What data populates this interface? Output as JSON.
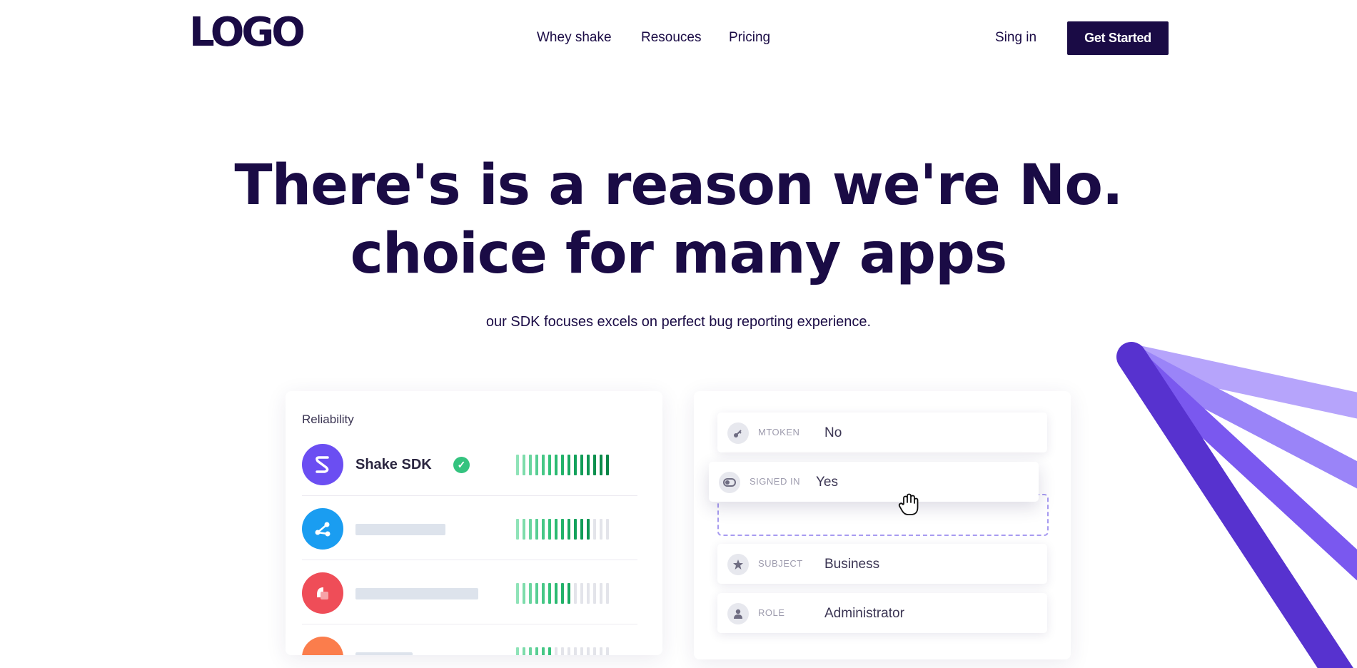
{
  "header": {
    "logo": "LOGO",
    "nav": [
      "Whey shake",
      "Resouces",
      "Pricing"
    ],
    "signin": "Sing in",
    "cta": "Get Started"
  },
  "hero": {
    "title_line1": "There's is a reason we're No.",
    "title_line2": "choice for many apps",
    "subtitle": "our SDK focuses excels on perfect bug reporting experience."
  },
  "reliability": {
    "title": "Reliability",
    "rows": [
      {
        "name": "Shake SDK",
        "verified": true,
        "icon": "shake-logo-icon",
        "color": "#6b4ef2",
        "score": 15,
        "total": 15
      },
      {
        "name": "",
        "icon": "share-network-icon",
        "color": "#1a9df1",
        "score": 12,
        "total": 15
      },
      {
        "name": "",
        "icon": "shape-icon",
        "color": "#ef4d58",
        "score": 9,
        "total": 15
      },
      {
        "name": "",
        "icon": "circle-icon",
        "color": "#fb7d4c",
        "score": 6,
        "total": 15
      }
    ]
  },
  "fields": [
    {
      "icon": "key-icon",
      "label": "MTOKEN",
      "value": "No"
    },
    {
      "icon": "toggle-icon",
      "label": "SIGNED IN",
      "value": "Yes"
    },
    {
      "icon": "star-icon",
      "label": "SUBJECT",
      "value": "Business"
    },
    {
      "icon": "user-icon",
      "label": "ROLE",
      "value": "Administrator"
    }
  ],
  "colors": {
    "brand": "#1a0b45",
    "accent_purple": "#6b4ef2",
    "success_green": "#34c37f"
  }
}
